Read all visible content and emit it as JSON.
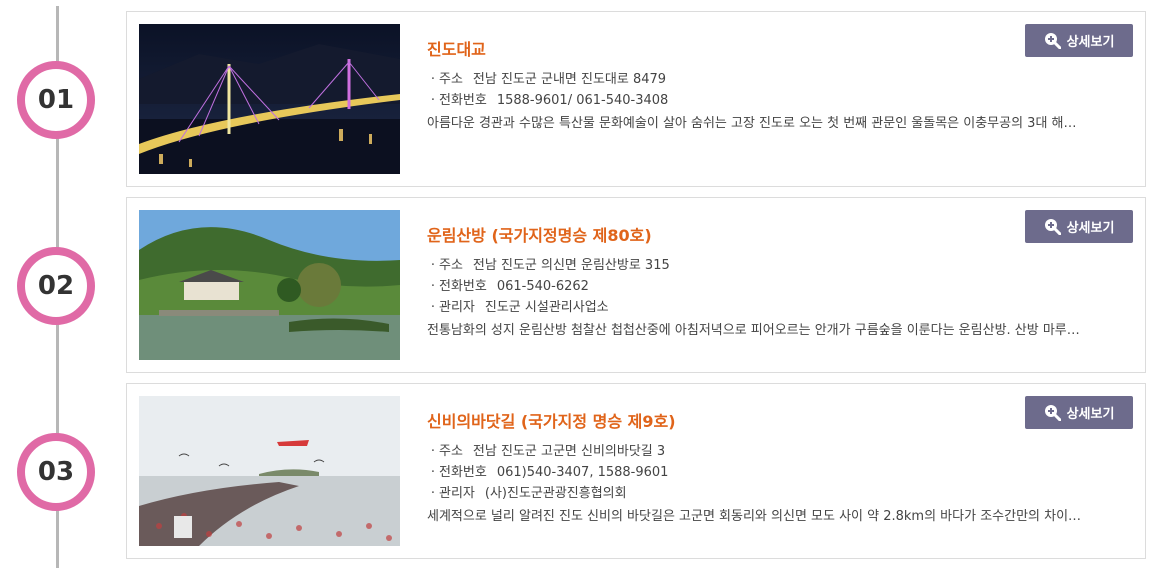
{
  "items": [
    {
      "number": "01",
      "title": "진도대교",
      "detail_label": "상세보기",
      "address_label": "주소",
      "address": "전남 진도군 군내면 진도대로 8479",
      "phone_label": "전화번호",
      "phone": "1588-9601/ 061-540-3408",
      "manager_label": "",
      "manager": "",
      "description": "아름다운 경관과 수많은 특산물 문화예술이 살아 숨쉬는 고장 진도로 오는 첫 번째 관문인 울돌목은 이충무공의 3대 해…",
      "image": "night-cable-bridge"
    },
    {
      "number": "02",
      "title": "운림산방 (국가지정명승 제80호)",
      "detail_label": "상세보기",
      "address_label": "주소",
      "address": "전남 진도군 의신면 운림산방로 315",
      "phone_label": "전화번호",
      "phone": "061-540-6262",
      "manager_label": "관리자",
      "manager": "진도군 시설관리사업소",
      "description": "전통남화의 성지 운림산방 첨찰산 첩첩산중에 아침저녁으로 피어오르는 안개가 구름숲을 이룬다는 운림산방. 산방 마루…",
      "image": "traditional-house-pond"
    },
    {
      "number": "03",
      "title": "신비의바닷길 (국가지정 명승 제9호)",
      "detail_label": "상세보기",
      "address_label": "주소",
      "address": "전남 진도군 고군면 신비의바닷길 3",
      "phone_label": "전화번호",
      "phone": "061)540-3407, 1588-9601",
      "manager_label": "관리자",
      "manager": "(사)진도군관광진흥협의회",
      "description": "세계적으로 널리 알려진 진도 신비의 바닷길은 고군면 회동리와 의신면 모도 사이 약 2.8km의 바다가 조수간만의 차이…",
      "image": "sea-road-crowd"
    }
  ],
  "icons": {
    "detail": "zoom-plus-icon",
    "bullet": "middle-dot"
  },
  "colors": {
    "badge_ring": "#e06aa6",
    "title": "#e0641a",
    "button": "#6d6b8c",
    "line": "#b7b7b7"
  }
}
